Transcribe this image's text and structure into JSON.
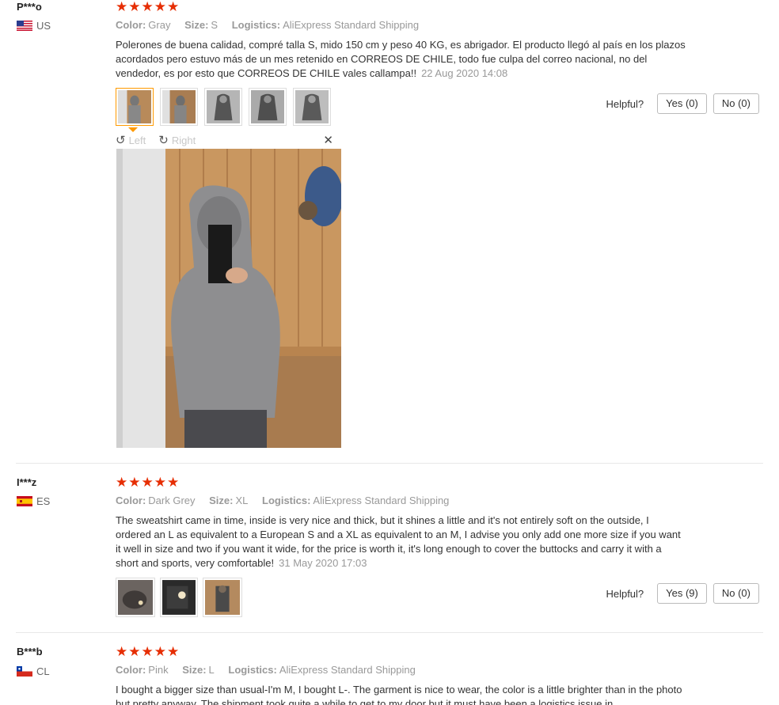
{
  "reviews": [
    {
      "user": "P***o",
      "country": "US",
      "stars": "★★★★★",
      "color_label": "Color:",
      "color": "Gray",
      "size_label": "Size:",
      "size": "S",
      "logistics_label": "Logistics:",
      "logistics": "AliExpress Standard Shipping",
      "text": "Polerones de buena calidad, compré talla S, mido 150 cm y peso 40 KG, es abrigador. El producto llegó al país en los plazos acordados pero estuvo más de un mes retenido en CORREOS DE CHILE, todo fue culpa del correo nacional, no del vendedor, es por esto que CORREOS DE CHILE vales callampa!!",
      "date": "22 Aug 2020 14:08",
      "helpful_label": "Helpful?",
      "yes": "Yes (0)",
      "no": "No (0)",
      "viewer": {
        "left": "Left",
        "right": "Right",
        "close": "✕",
        "rotate_left_icon": "↺",
        "rotate_right_icon": "↻"
      }
    },
    {
      "user": "I***z",
      "country": "ES",
      "stars": "★★★★★",
      "color_label": "Color:",
      "color": "Dark Grey",
      "size_label": "Size:",
      "size": "XL",
      "logistics_label": "Logistics:",
      "logistics": "AliExpress Standard Shipping",
      "text": "The sweatshirt came in time, inside is very nice and thick, but it shines a little and it's not entirely soft on the outside, I ordered an L as equivalent to a European S and a XL as equivalent to an M, I advise you only add one more size if you want it well in size and two if you want it wide, for the price is worth it, it's long enough to cover the buttocks and carry it with a short and sports, very comfortable!",
      "date": "31 May 2020 17:03",
      "helpful_label": "Helpful?",
      "yes": "Yes (9)",
      "no": "No (0)"
    },
    {
      "user": "B***b",
      "country": "CL",
      "stars": "★★★★★",
      "color_label": "Color:",
      "color": "Pink",
      "size_label": "Size:",
      "size": "L",
      "logistics_label": "Logistics:",
      "logistics": "AliExpress Standard Shipping",
      "text": "I bought a bigger size than usual-I'm M, I bought L-. The garment is nice to wear, the color is a little brighter than in the photo but pretty anyway. The shipment took quite a while to get to my door but it must have been a logistics issue in"
    }
  ],
  "colors": {
    "star": "#e62e04",
    "active_thumb": "#ff9a00",
    "muted": "#999999"
  }
}
